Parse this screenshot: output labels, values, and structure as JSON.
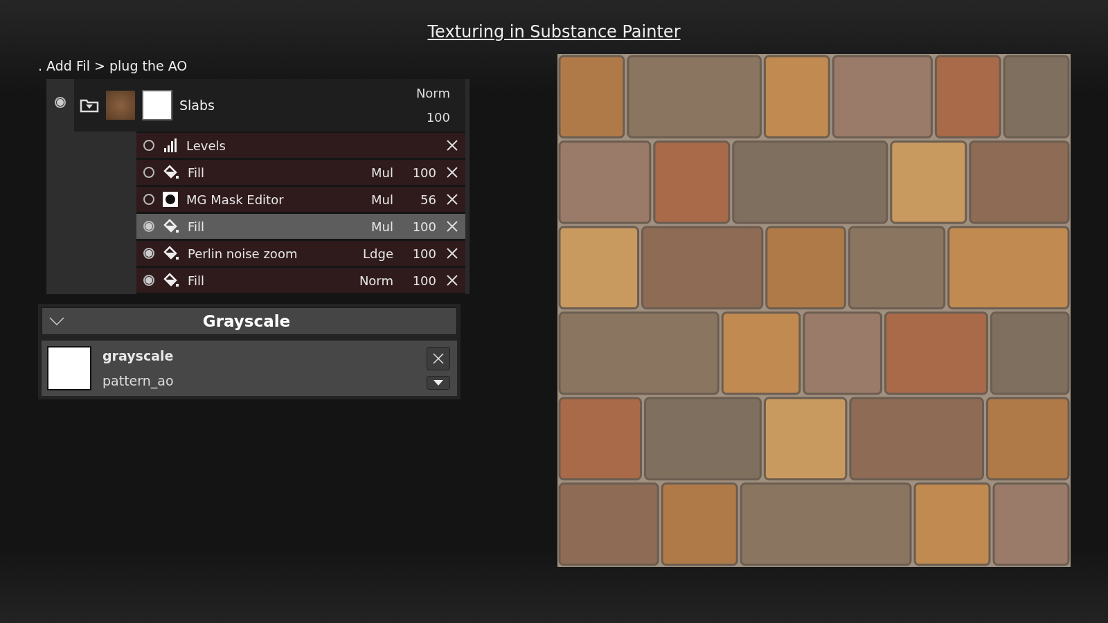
{
  "slide_title": "Texturing in Substance Painter",
  "instruction": ". Add Fil > plug the AO",
  "layer": {
    "name": "Slabs",
    "blend": "Norm",
    "opacity": "100",
    "visible": true
  },
  "effects": [
    {
      "kind": "levels",
      "name": "Levels",
      "visible": false,
      "selected": false
    },
    {
      "kind": "fill",
      "name": "Fill",
      "blend": "Mul",
      "opacity": "100",
      "visible": false,
      "selected": false
    },
    {
      "kind": "mask",
      "name": "MG Mask Editor",
      "blend": "Mul",
      "opacity": "56",
      "visible": false,
      "selected": false
    },
    {
      "kind": "fill",
      "name": "Fill",
      "blend": "Mul",
      "opacity": "100",
      "visible": true,
      "selected": true
    },
    {
      "kind": "fill",
      "name": "Perlin noise zoom",
      "blend": "Ldge",
      "opacity": "100",
      "visible": true,
      "selected": false
    },
    {
      "kind": "fill",
      "name": "Fill",
      "blend": "Norm",
      "opacity": "100",
      "visible": true,
      "selected": false
    }
  ],
  "property_panel": {
    "title": "Grayscale",
    "expanded": true,
    "resource_name": "grayscale",
    "resource_file": "pattern_ao"
  }
}
